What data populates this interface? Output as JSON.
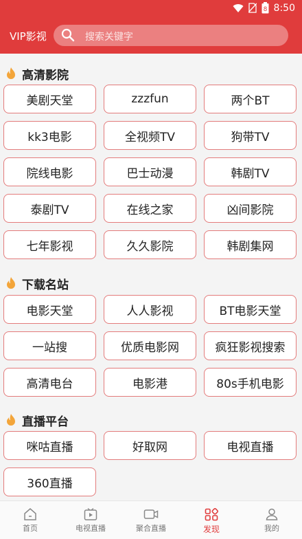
{
  "status": {
    "time": "8:50",
    "battery": "8"
  },
  "header": {
    "title": "VIP影视",
    "search_placeholder": "搜索关键字"
  },
  "sections": [
    {
      "title": "高清影院",
      "sites": [
        "美剧天堂",
        "zzzfun",
        "两个BT",
        "kk3电影",
        "全视频TV",
        "狗带TV",
        "院线电影",
        "巴士动漫",
        "韩剧TV",
        "泰剧TV",
        "在线之家",
        "凶间影院",
        "七年影视",
        "久久影院",
        "韩剧集网"
      ]
    },
    {
      "title": "下载名站",
      "sites": [
        "电影天堂",
        "人人影视",
        "BT电影天堂",
        "一站搜",
        "优质电影网",
        "疯狂影视搜索",
        "高清电台",
        "电影港",
        "80s手机电影"
      ]
    },
    {
      "title": "直播平台",
      "sites": [
        "咪咕直播",
        "好取网",
        "电视直播",
        "360直播"
      ]
    }
  ],
  "nav": [
    {
      "label": "首页",
      "icon": "home-icon"
    },
    {
      "label": "电视直播",
      "icon": "tv-icon"
    },
    {
      "label": "聚合直播",
      "icon": "video-camera-icon"
    },
    {
      "label": "发现",
      "icon": "grid-icon",
      "active": true
    },
    {
      "label": "我的",
      "icon": "user-icon"
    }
  ],
  "colors": {
    "accent": "#e03c3c",
    "tile_border": "#e37b7b",
    "background": "#f4f4f4"
  }
}
